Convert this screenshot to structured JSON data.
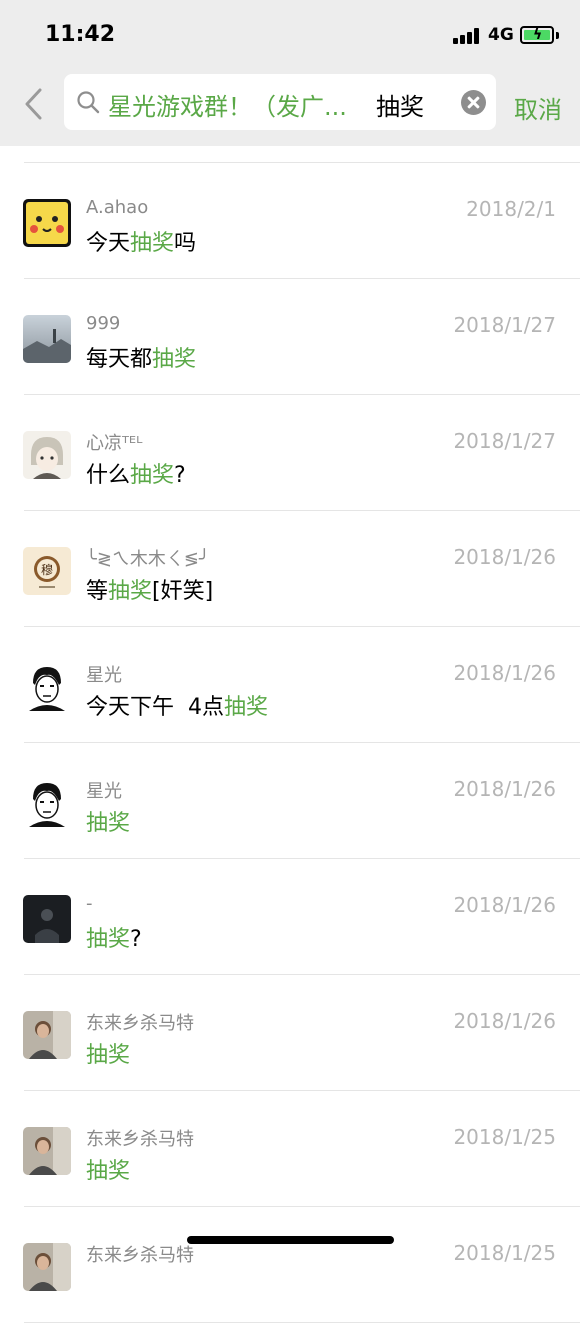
{
  "status": {
    "time": "11:42",
    "network": "4G"
  },
  "search": {
    "group_name": "星光游戏群！（发广...",
    "query": "抽奖",
    "cancel_label": "取消"
  },
  "results": [
    {
      "name": "A.ahao",
      "date": "2018/2/1",
      "before": "今天",
      "highlight": "抽奖",
      "after": "吗",
      "avatar": "pikachu-avatar"
    },
    {
      "name": "999",
      "date": "2018/1/27",
      "before": "每天都",
      "highlight": "抽奖",
      "after": "",
      "avatar": "landscape-avatar"
    },
    {
      "name": "心凉ᵀᴱᴸ",
      "date": "2018/1/27",
      "before": "什么",
      "highlight": "抽奖",
      "after": "?",
      "avatar": "anime-avatar"
    },
    {
      "name": "╰≷ㄟ木木ㄑ≶╯",
      "date": "2018/1/26",
      "before": "等",
      "highlight": "抽奖",
      "after": "[奸笑]",
      "avatar": "seal-avatar"
    },
    {
      "name": "星光",
      "date": "2018/1/26",
      "before": "今天下午  4点",
      "highlight": "抽奖",
      "after": "",
      "avatar": "sketch-face-avatar"
    },
    {
      "name": "星光",
      "date": "2018/1/26",
      "before": "",
      "highlight": "抽奖",
      "after": "",
      "avatar": "sketch-face-avatar"
    },
    {
      "name": "-",
      "date": "2018/1/26",
      "before": "",
      "highlight": "抽奖",
      "after": "?",
      "avatar": "dark-photo-avatar"
    },
    {
      "name": "东来乡杀马特",
      "date": "2018/1/26",
      "before": "",
      "highlight": "抽奖",
      "after": "",
      "avatar": "person-photo-avatar"
    },
    {
      "name": "东来乡杀马特",
      "date": "2018/1/25",
      "before": "",
      "highlight": "抽奖",
      "after": "",
      "avatar": "person-photo-avatar"
    },
    {
      "name": "东来乡杀马特",
      "date": "2018/1/25",
      "before": "",
      "highlight": "",
      "after": "",
      "avatar": "person-photo-avatar"
    }
  ],
  "colors": {
    "accent": "#5aa847",
    "header_bg": "#ededed",
    "date": "#b5b5b5",
    "name": "#8a8a8a"
  }
}
